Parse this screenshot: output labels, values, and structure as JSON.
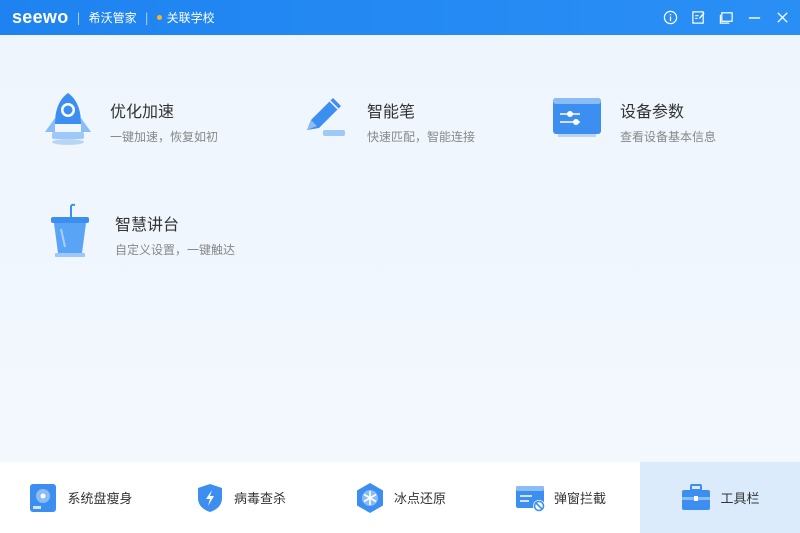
{
  "titlebar": {
    "logo": "seewo",
    "app_name": "希沃管家",
    "school": "关联学校"
  },
  "tools": [
    {
      "title": "优化加速",
      "desc": "一键加速，恢复如初",
      "icon": "rocket-icon"
    },
    {
      "title": "智能笔",
      "desc": "快速匹配，智能连接",
      "icon": "pen-icon"
    },
    {
      "title": "设备参数",
      "desc": "查看设备基本信息",
      "icon": "device-settings-icon"
    },
    {
      "title": "智慧讲台",
      "desc": "自定义设置，一键触达",
      "icon": "podium-icon"
    }
  ],
  "bottom_nav": [
    {
      "label": "系统盘瘦身",
      "icon": "disk-icon"
    },
    {
      "label": "病毒查杀",
      "icon": "shield-icon"
    },
    {
      "label": "冰点还原",
      "icon": "snowflake-icon"
    },
    {
      "label": "弹窗拦截",
      "icon": "popup-block-icon"
    },
    {
      "label": "工具栏",
      "icon": "toolbox-icon",
      "active": true
    }
  ],
  "colors": {
    "accent": "#1e83f0",
    "active_tab": "#dcebfc"
  }
}
